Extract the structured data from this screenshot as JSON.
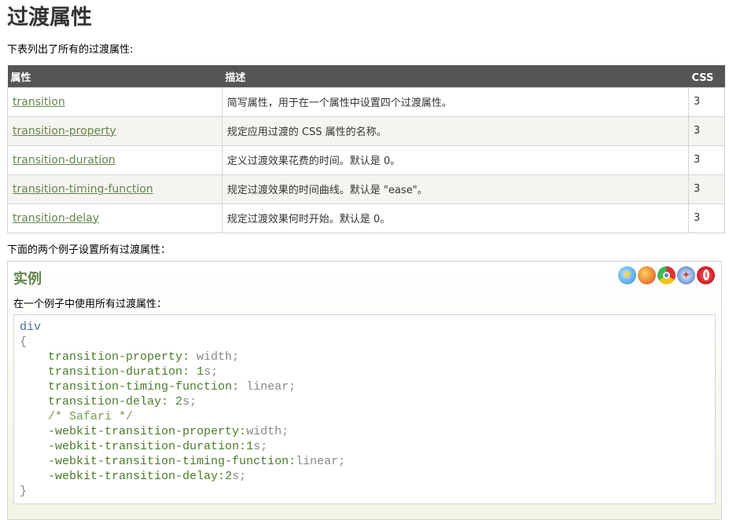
{
  "title": "过渡属性",
  "intro": "下表列出了所有的过渡属性:",
  "table": {
    "headers": [
      "属性",
      "描述",
      "CSS"
    ],
    "rows": [
      {
        "name": "transition",
        "desc": "简写属性，用于在一个属性中设置四个过渡属性。",
        "css": "3"
      },
      {
        "name": "transition-property",
        "desc": "规定应用过渡的 CSS 属性的名称。",
        "css": "3"
      },
      {
        "name": "transition-duration",
        "desc": "定义过渡效果花费的时间。默认是 0。",
        "css": "3"
      },
      {
        "name": "transition-timing-function",
        "desc": "规定过渡效果的时间曲线。默认是 \"ease\"。",
        "css": "3"
      },
      {
        "name": "transition-delay",
        "desc": "规定过渡效果何时开始。默认是 0。",
        "css": "3"
      }
    ]
  },
  "second_intro": "下面的两个例子设置所有过渡属性：",
  "example": {
    "heading": "实例",
    "browser_icons": [
      "ie-icon",
      "firefox-icon",
      "chrome-icon",
      "safari-icon",
      "opera-icon"
    ],
    "intro": "在一个例子中使用所有过渡属性：",
    "code": {
      "selector": "div",
      "open": "{",
      "close": "}",
      "lines": [
        {
          "prop": "transition-property:",
          "val": " width;"
        },
        {
          "prop": "transition-duration:",
          "num": " 1",
          "val": "s;"
        },
        {
          "prop": "transition-timing-function:",
          "val": " linear;"
        },
        {
          "prop": "transition-delay:",
          "num": " 2",
          "val": "s;"
        },
        {
          "comment": "/* Safari */"
        },
        {
          "prop": "-webkit-transition-property:",
          "val": "width;"
        },
        {
          "prop": "-webkit-transition-duration:",
          "num": "1",
          "val": "s;"
        },
        {
          "prop": "-webkit-transition-timing-function:",
          "val": "linear;"
        },
        {
          "prop": "-webkit-transition-delay:",
          "num": "2",
          "val": "s;"
        }
      ]
    }
  }
}
